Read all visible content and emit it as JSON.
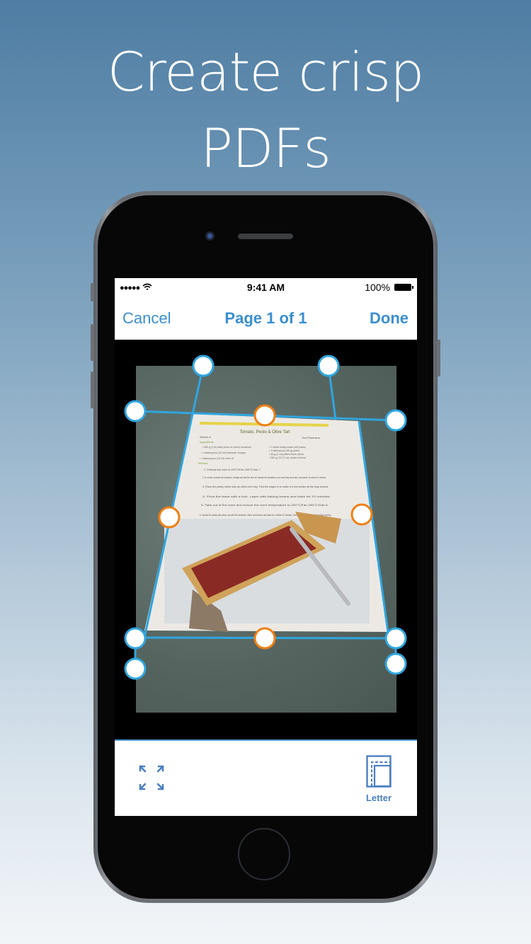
{
  "headline": {
    "line1": "Create crisp",
    "line2": "PDFs"
  },
  "status_bar": {
    "signal": "●●●●●",
    "wifi_icon": "wifi-icon",
    "time": "9:41 AM",
    "battery": "100%"
  },
  "nav": {
    "cancel_label": "Cancel",
    "title": "Page 1 of 1",
    "done_label": "Done"
  },
  "document": {
    "title": "Tomato, Pesto & Olive Tart",
    "serves": "Serves 4",
    "author": "Don Robinson",
    "ingredients_heading": "Ingredients",
    "ingredients_left": [
      "500 g (1 lb) baby plum or cherry tomatoes",
      "1 tablespoon (15 ml) balsamic vinegar",
      "1 tablespoon (15 ml) olive oil"
    ],
    "ingredients_right": [
      "1 sheet ready-made puff pastry",
      "2 tablespoon (30 g) pesto",
      "55 g (2 oz) pitted black olives",
      "380 g (12-13 oz) ricotta cheese"
    ],
    "method_heading": "Method",
    "steps": [
      "Preheat the oven to 200°C/Fan 200°C/Gas 7.",
      "In a bowl, combine the tomatoes, vinegar and half the olive oil. Spread the tomatoes on an oven tray and roast, uncovered, for about 10 minutes.",
      "Place the pastry sheet onto an oiled oven tray. Fold the edges in to make a 5 mm border all the way around.",
      "Prick the base with a fork. Layer with baking beans and bake for 10 minutes.",
      "Take out of the oven and reduce the oven temperature to 200°C/Fan 180°C/Gas 6.",
      "Spread the pastry with pesto, top with the tomatoes, olives and cheese and bake for a further 10 minutes. Drizzle with the remaining oil before serving."
    ]
  },
  "toolbar": {
    "expand_icon": "expand-icon",
    "page_size_label": "Letter"
  },
  "colors": {
    "accent": "#3a8fd1",
    "crop_line": "#2fa6e0",
    "midpoint_handle": "#f07f12",
    "corner_handle": "#2fa6e0"
  }
}
